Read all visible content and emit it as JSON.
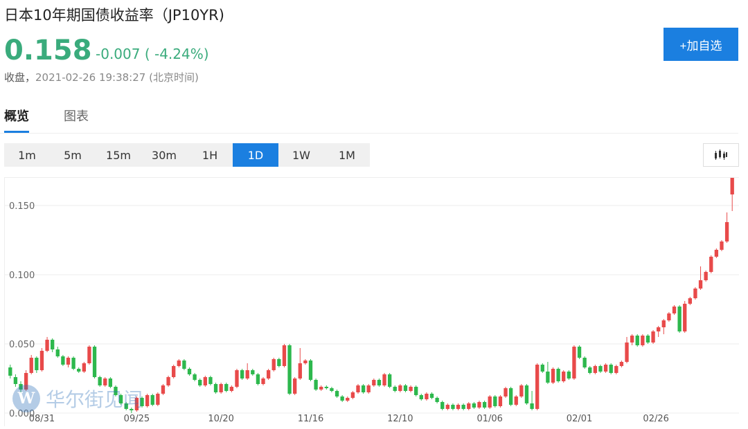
{
  "header": {
    "title": "日本10年期国债收益率（JP10YR)",
    "price": "0.158",
    "change": "-0.007 ( -4.24%)",
    "status_label": "收盘，",
    "status_time": "2021-02-26 19:38:27 (北京时间)",
    "add_button": "+加自选"
  },
  "tabs": [
    {
      "label": "概览",
      "active": true
    },
    {
      "label": "图表",
      "active": false
    }
  ],
  "periods": [
    {
      "label": "1m",
      "active": false
    },
    {
      "label": "5m",
      "active": false
    },
    {
      "label": "15m",
      "active": false
    },
    {
      "label": "30m",
      "active": false
    },
    {
      "label": "1H",
      "active": false
    },
    {
      "label": "1D",
      "active": true
    },
    {
      "label": "1W",
      "active": false
    },
    {
      "label": "1M",
      "active": false
    }
  ],
  "chart_type_icon": "candlestick-icon",
  "watermark": {
    "logo": "W",
    "text": "华尔街见闻"
  },
  "colors": {
    "up": "#e84a4a",
    "down": "#2db84d",
    "accent": "#1b7fe0",
    "price": "#3aab7c"
  },
  "chart_data": {
    "type": "candlestick",
    "ylim": [
      0.0,
      0.17
    ],
    "yticks": [
      {
        "value": 0.15,
        "label": "0.150"
      },
      {
        "value": 0.1,
        "label": "0.100"
      },
      {
        "value": 0.05,
        "label": "0.050"
      },
      {
        "value": 0.0,
        "label": "0.000"
      }
    ],
    "xticks": [
      {
        "index": 6,
        "label": "08/31"
      },
      {
        "index": 24,
        "label": "09/25"
      },
      {
        "index": 40,
        "label": "10/20"
      },
      {
        "index": 57,
        "label": "11/16"
      },
      {
        "index": 74,
        "label": "12/10"
      },
      {
        "index": 91,
        "label": "01/06"
      },
      {
        "index": 108,
        "label": "02/01"
      },
      {
        "index": 125,
        "label": "02/26"
      }
    ],
    "candles": [
      [
        0.033,
        0.027,
        0.035,
        0.025
      ],
      [
        0.026,
        0.021,
        0.028,
        0.019
      ],
      [
        0.021,
        0.017,
        0.023,
        0.015
      ],
      [
        0.017,
        0.029,
        0.031,
        0.016
      ],
      [
        0.029,
        0.04,
        0.042,
        0.028
      ],
      [
        0.04,
        0.031,
        0.041,
        0.029
      ],
      [
        0.031,
        0.045,
        0.047,
        0.03
      ],
      [
        0.045,
        0.053,
        0.055,
        0.044
      ],
      [
        0.053,
        0.046,
        0.054,
        0.044
      ],
      [
        0.046,
        0.041,
        0.048,
        0.04
      ],
      [
        0.041,
        0.035,
        0.042,
        0.034
      ],
      [
        0.035,
        0.04,
        0.041,
        0.033
      ],
      [
        0.04,
        0.032,
        0.041,
        0.031
      ],
      [
        0.032,
        0.03,
        0.033,
        0.029
      ],
      [
        0.03,
        0.036,
        0.037,
        0.029
      ],
      [
        0.036,
        0.048,
        0.049,
        0.035
      ],
      [
        0.048,
        0.026,
        0.049,
        0.025
      ],
      [
        0.026,
        0.02,
        0.027,
        0.019
      ],
      [
        0.02,
        0.025,
        0.026,
        0.019
      ],
      [
        0.025,
        0.019,
        0.026,
        0.018
      ],
      [
        0.019,
        0.013,
        0.02,
        0.012
      ],
      [
        0.013,
        0.007,
        0.014,
        0.006
      ],
      [
        0.007,
        0.003,
        0.008,
        0.002
      ],
      [
        0.003,
        0.002,
        0.004,
        0.0
      ],
      [
        0.002,
        0.011,
        0.012,
        0.001
      ],
      [
        0.011,
        0.005,
        0.012,
        0.004
      ],
      [
        0.005,
        0.013,
        0.014,
        0.004
      ],
      [
        0.013,
        0.006,
        0.014,
        0.005
      ],
      [
        0.006,
        0.014,
        0.015,
        0.005
      ],
      [
        0.014,
        0.02,
        0.021,
        0.013
      ],
      [
        0.02,
        0.026,
        0.027,
        0.019
      ],
      [
        0.026,
        0.034,
        0.035,
        0.025
      ],
      [
        0.034,
        0.038,
        0.039,
        0.033
      ],
      [
        0.038,
        0.032,
        0.039,
        0.031
      ],
      [
        0.032,
        0.028,
        0.033,
        0.027
      ],
      [
        0.028,
        0.024,
        0.029,
        0.023
      ],
      [
        0.024,
        0.02,
        0.025,
        0.019
      ],
      [
        0.02,
        0.026,
        0.027,
        0.019
      ],
      [
        0.026,
        0.021,
        0.027,
        0.02
      ],
      [
        0.021,
        0.015,
        0.022,
        0.014
      ],
      [
        0.015,
        0.021,
        0.022,
        0.014
      ],
      [
        0.021,
        0.016,
        0.022,
        0.015
      ],
      [
        0.016,
        0.019,
        0.02,
        0.015
      ],
      [
        0.019,
        0.031,
        0.032,
        0.018
      ],
      [
        0.031,
        0.025,
        0.032,
        0.024
      ],
      [
        0.025,
        0.031,
        0.036,
        0.024
      ],
      [
        0.031,
        0.028,
        0.032,
        0.027
      ],
      [
        0.028,
        0.021,
        0.029,
        0.02
      ],
      [
        0.021,
        0.025,
        0.026,
        0.02
      ],
      [
        0.025,
        0.031,
        0.032,
        0.024
      ],
      [
        0.031,
        0.039,
        0.04,
        0.03
      ],
      [
        0.039,
        0.034,
        0.04,
        0.033
      ],
      [
        0.034,
        0.049,
        0.05,
        0.033
      ],
      [
        0.049,
        0.014,
        0.05,
        0.013
      ],
      [
        0.014,
        0.025,
        0.026,
        0.013
      ],
      [
        0.025,
        0.036,
        0.047,
        0.024
      ],
      [
        0.036,
        0.038,
        0.039,
        0.035
      ],
      [
        0.038,
        0.024,
        0.039,
        0.023
      ],
      [
        0.024,
        0.017,
        0.025,
        0.016
      ],
      [
        0.017,
        0.019,
        0.02,
        0.016
      ],
      [
        0.019,
        0.018,
        0.02,
        0.017
      ],
      [
        0.018,
        0.016,
        0.019,
        0.015
      ],
      [
        0.016,
        0.012,
        0.017,
        0.011
      ],
      [
        0.012,
        0.009,
        0.013,
        0.008
      ],
      [
        0.009,
        0.011,
        0.012,
        0.008
      ],
      [
        0.011,
        0.015,
        0.016,
        0.01
      ],
      [
        0.015,
        0.02,
        0.021,
        0.014
      ],
      [
        0.02,
        0.015,
        0.021,
        0.014
      ],
      [
        0.015,
        0.02,
        0.021,
        0.014
      ],
      [
        0.02,
        0.024,
        0.025,
        0.019
      ],
      [
        0.024,
        0.02,
        0.025,
        0.019
      ],
      [
        0.02,
        0.028,
        0.029,
        0.019
      ],
      [
        0.028,
        0.019,
        0.029,
        0.018
      ],
      [
        0.019,
        0.016,
        0.02,
        0.015
      ],
      [
        0.016,
        0.02,
        0.021,
        0.015
      ],
      [
        0.02,
        0.016,
        0.021,
        0.015
      ],
      [
        0.016,
        0.019,
        0.02,
        0.015
      ],
      [
        0.019,
        0.013,
        0.02,
        0.012
      ],
      [
        0.013,
        0.01,
        0.014,
        0.009
      ],
      [
        0.01,
        0.014,
        0.015,
        0.009
      ],
      [
        0.014,
        0.011,
        0.015,
        0.01
      ],
      [
        0.011,
        0.008,
        0.012,
        0.007
      ],
      [
        0.008,
        0.003,
        0.009,
        0.002
      ],
      [
        0.003,
        0.006,
        0.007,
        0.002
      ],
      [
        0.006,
        0.003,
        0.007,
        0.002
      ],
      [
        0.003,
        0.006,
        0.007,
        0.002
      ],
      [
        0.006,
        0.003,
        0.007,
        0.002
      ],
      [
        0.003,
        0.007,
        0.008,
        0.002
      ],
      [
        0.007,
        0.004,
        0.008,
        0.003
      ],
      [
        0.004,
        0.008,
        0.009,
        0.003
      ],
      [
        0.008,
        0.004,
        0.009,
        0.003
      ],
      [
        0.004,
        0.012,
        0.013,
        0.003
      ],
      [
        0.012,
        0.005,
        0.013,
        0.004
      ],
      [
        0.005,
        0.012,
        0.013,
        0.004
      ],
      [
        0.012,
        0.018,
        0.019,
        0.011
      ],
      [
        0.018,
        0.006,
        0.019,
        0.005
      ],
      [
        0.006,
        0.012,
        0.013,
        0.005
      ],
      [
        0.012,
        0.02,
        0.021,
        0.011
      ],
      [
        0.02,
        0.007,
        0.021,
        0.006
      ],
      [
        0.007,
        0.003,
        0.016,
        0.002
      ],
      [
        0.003,
        0.035,
        0.036,
        0.002
      ],
      [
        0.035,
        0.03,
        0.036,
        0.029
      ],
      [
        0.03,
        0.022,
        0.037,
        0.021
      ],
      [
        0.022,
        0.032,
        0.033,
        0.021
      ],
      [
        0.032,
        0.023,
        0.033,
        0.022
      ],
      [
        0.023,
        0.03,
        0.031,
        0.022
      ],
      [
        0.03,
        0.025,
        0.031,
        0.024
      ],
      [
        0.025,
        0.048,
        0.049,
        0.024
      ],
      [
        0.048,
        0.04,
        0.049,
        0.039
      ],
      [
        0.04,
        0.033,
        0.041,
        0.032
      ],
      [
        0.033,
        0.029,
        0.034,
        0.028
      ],
      [
        0.029,
        0.034,
        0.035,
        0.028
      ],
      [
        0.034,
        0.03,
        0.035,
        0.029
      ],
      [
        0.03,
        0.035,
        0.036,
        0.029
      ],
      [
        0.035,
        0.029,
        0.036,
        0.028
      ],
      [
        0.029,
        0.034,
        0.035,
        0.028
      ],
      [
        0.034,
        0.037,
        0.038,
        0.033
      ],
      [
        0.037,
        0.051,
        0.055,
        0.036
      ],
      [
        0.051,
        0.056,
        0.057,
        0.049
      ],
      [
        0.056,
        0.049,
        0.057,
        0.048
      ],
      [
        0.049,
        0.056,
        0.057,
        0.048
      ],
      [
        0.056,
        0.051,
        0.057,
        0.05
      ],
      [
        0.051,
        0.059,
        0.06,
        0.05
      ],
      [
        0.059,
        0.062,
        0.063,
        0.055
      ],
      [
        0.062,
        0.067,
        0.068,
        0.057
      ],
      [
        0.067,
        0.072,
        0.073,
        0.066
      ],
      [
        0.072,
        0.077,
        0.078,
        0.071
      ],
      [
        0.077,
        0.059,
        0.078,
        0.058
      ],
      [
        0.059,
        0.079,
        0.081,
        0.058
      ],
      [
        0.079,
        0.083,
        0.084,
        0.078
      ],
      [
        0.083,
        0.09,
        0.091,
        0.082
      ],
      [
        0.09,
        0.096,
        0.106,
        0.089
      ],
      [
        0.096,
        0.102,
        0.103,
        0.095
      ],
      [
        0.102,
        0.113,
        0.114,
        0.101
      ],
      [
        0.113,
        0.118,
        0.119,
        0.112
      ],
      [
        0.118,
        0.124,
        0.125,
        0.117
      ],
      [
        0.124,
        0.138,
        0.145,
        0.123
      ],
      [
        0.158,
        0.172,
        0.173,
        0.146
      ]
    ]
  }
}
